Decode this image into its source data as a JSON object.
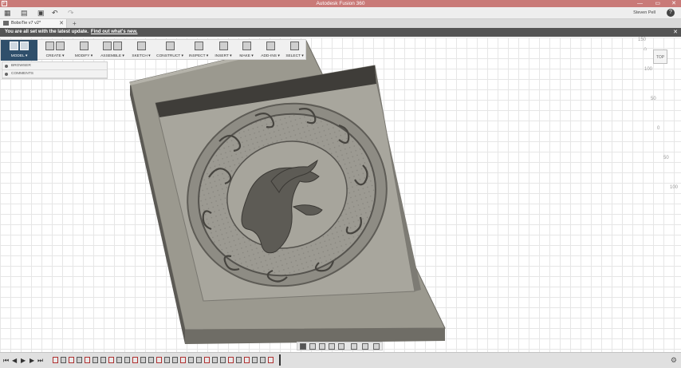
{
  "window": {
    "title": "Autodesk Fusion 360",
    "app_icon": "F",
    "minimize": "—",
    "restore": "▭",
    "close": "✕"
  },
  "qat": {
    "user": "Steven Pell",
    "help": "?",
    "user_arrow": "▾"
  },
  "tab": {
    "label": "BoboTie v7 v2*",
    "close": "✕",
    "add": "+"
  },
  "banner": {
    "message": "You are all set with the latest update.",
    "link": "Find out what's new.",
    "close": "✕"
  },
  "toolbar": {
    "workspace": "MODEL ▾",
    "items": [
      "CREATE ▾",
      "MODIFY ▾",
      "ASSEMBLE ▾",
      "SKETCH ▾",
      "CONSTRUCT ▾",
      "INSPECT ▾",
      "INSERT ▾",
      "MAKE ▾",
      "ADD-INS ▾",
      "SELECT ▾"
    ]
  },
  "browser": {
    "items": [
      "BROWSER",
      "COMMENTS"
    ]
  },
  "viewcube": {
    "face": "TOP",
    "home": "⌂"
  },
  "ruler": {
    "r1": "150",
    "r2": "100",
    "r3": "50",
    "r4": "0",
    "r5": "50",
    "r6": "100"
  },
  "colors": {
    "accent": "#2f4f6b",
    "titlebar": "#c97a78",
    "banner": "#545454",
    "model": "#8c8a82"
  },
  "icons": [
    "grid-icon",
    "file-icon",
    "save-icon",
    "undo-icon",
    "redo-icon",
    "help-icon",
    "gear-icon",
    "home-icon"
  ]
}
